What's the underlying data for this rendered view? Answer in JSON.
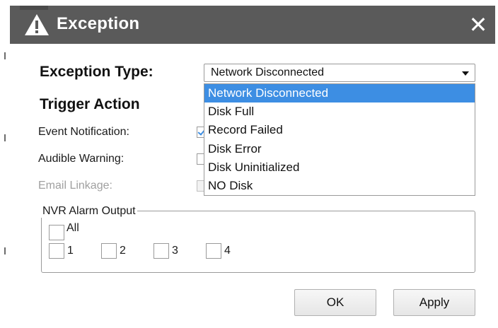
{
  "dialog": {
    "title": "Exception",
    "close_glyph": "✕",
    "title_icon": "warning-icon"
  },
  "exception_type": {
    "label": "Exception Type:",
    "selected": "Network Disconnected",
    "options": [
      "Network Disconnected",
      "Disk Full",
      "Record Failed",
      "Disk Error",
      "Disk Uninitialized",
      "NO Disk"
    ]
  },
  "trigger_action": {
    "heading": "Trigger Action",
    "event_notification": "Event Notification:",
    "audible_warning": "Audible Warning:",
    "email_linkage": "Email Linkage:"
  },
  "alarm_output": {
    "legend": "NVR Alarm Output",
    "all_label": "All",
    "outputs": [
      "1",
      "2",
      "3",
      "4"
    ]
  },
  "buttons": {
    "ok": "OK",
    "apply": "Apply"
  },
  "colors": {
    "titlebar": "#5a5a5a",
    "selection": "#3d8ee3"
  }
}
